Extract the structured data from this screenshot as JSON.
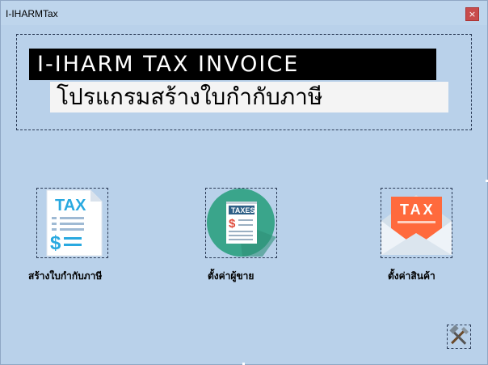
{
  "window": {
    "title": "I-IHARMTax",
    "close_glyph": "×"
  },
  "banner": {
    "line1": "I-IHARM TAX INVOICE",
    "line2": "โปรแกรมสร้างใบกำกับภาษี"
  },
  "tiles": [
    {
      "label": "สร้างใบกำกับภาษี",
      "icon": "tax-invoice-document-icon"
    },
    {
      "label": "ตั้งค่าผู้ขาย",
      "icon": "taxes-circle-icon",
      "icon_text": "TAXES"
    },
    {
      "label": "ตั้งค่าสินค้า",
      "icon": "tax-envelope-icon"
    }
  ],
  "icon_texts": {
    "doc_tax": "TAX",
    "doc_dollar": "$",
    "circle_taxes": "TAXES",
    "circle_dollar": "$",
    "envelope_tax": "TAX"
  },
  "settings_icon": "tools-icon",
  "colors": {
    "window_bg": "#b9d1ea",
    "close_button": "#c84c4c",
    "tax_blue": "#29a9e0",
    "teal": "#3aa58b",
    "orange": "#ff6a3d"
  }
}
